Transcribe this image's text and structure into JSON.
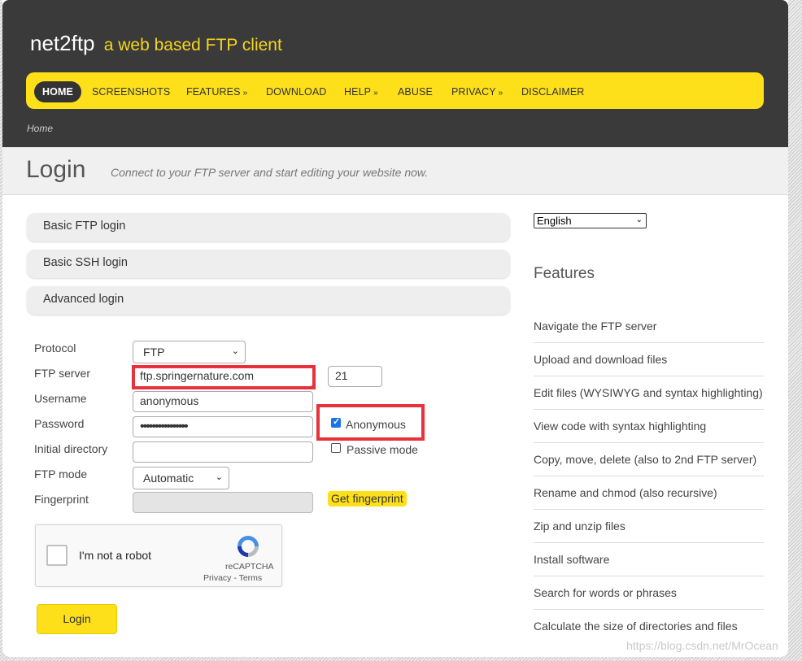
{
  "header": {
    "brand": "net2ftp",
    "tagline": "a web based FTP client",
    "nav": [
      {
        "label": "HOME",
        "arrow": ""
      },
      {
        "label": "SCREENSHOTS",
        "arrow": ""
      },
      {
        "label": "FEATURES",
        "arrow": "»"
      },
      {
        "label": "DOWNLOAD",
        "arrow": ""
      },
      {
        "label": "HELP",
        "arrow": "»"
      },
      {
        "label": "ABUSE",
        "arrow": ""
      },
      {
        "label": "PRIVACY",
        "arrow": "»"
      },
      {
        "label": "DISCLAIMER",
        "arrow": ""
      }
    ],
    "breadcrumb": "Home"
  },
  "title": {
    "heading": "Login",
    "subtitle": "Connect to your FTP server and start editing your website now."
  },
  "accordion": [
    "Basic FTP login",
    "Basic SSH login",
    "Advanced login"
  ],
  "form": {
    "protocol_label": "Protocol",
    "protocol_value": "FTP",
    "server_label": "FTP server",
    "server_value": "ftp.springernature.com",
    "port_value": "21",
    "username_label": "Username",
    "username_value": "anonymous",
    "password_label": "Password",
    "password_value": "••••••••••••••••",
    "anonymous_label": "Anonymous",
    "anonymous_checked": true,
    "initial_dir_label": "Initial directory",
    "initial_dir_value": "",
    "passive_label": "Passive mode",
    "passive_checked": false,
    "ftp_mode_label": "FTP mode",
    "ftp_mode_value": "Automatic",
    "fingerprint_label": "Fingerprint",
    "fingerprint_value": "",
    "get_fingerprint": "Get fingerprint"
  },
  "recaptcha": {
    "label": "I'm not a robot",
    "brand": "reCAPTCHA",
    "privacy": "Privacy",
    "separator": " - ",
    "terms": "Terms"
  },
  "login_button": "Login",
  "sidebar": {
    "language": "English",
    "features_title": "Features",
    "features": [
      "Navigate the FTP server",
      "Upload and download files",
      "Edit files (WYSIWYG and syntax highlighting)",
      "View code with syntax highlighting",
      "Copy, move, delete (also to 2nd FTP server)",
      "Rename and chmod (also recursive)",
      "Zip and unzip files",
      "Install software",
      "Search for words or phrases",
      "Calculate the size of directories and files"
    ]
  },
  "watermark": "https://blog.csdn.net/MrOcean",
  "colors": {
    "header_bg": "#3a3a3a",
    "accent_yellow": "#fde01a",
    "highlight_red": "#e8313a",
    "checkbox_blue": "#1a73e8"
  }
}
